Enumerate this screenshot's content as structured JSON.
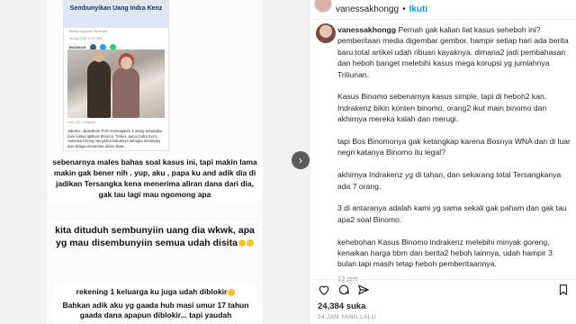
{
  "article": {
    "title": "Sembunyikan Uang Indra Kenz",
    "meta": "Rabiha Adiyanto Rachmadi",
    "date": "25 Ags 2022 11:00 WIB",
    "share_label": "BAGIKAN",
    "comment_label": "Komentar",
    "photo_caption": "Foto: dok. Instagram",
    "body": "Jakarta - Bareskrim Polri menetapkan 3 orang tersangka baru kasus aplikasi Binomo. Terkini, pacar Indra Kenz, Vanessa Khong menyebut kakaknya sebagai tersangka dan diduga menerima aliran dana..."
  },
  "story_text": {
    "b1": "sebenarnya males bahas soal kasus ini, tapi makin lama makin gak bener nih . yup, aku , papa ku and adik dia di jadikan Tersangka kena menerima aliran dana dari dia, gak tau lagi mau ngomong apa",
    "b2": "kita dituduh sembunyiin uang dia wkwk, apa yg mau disembunyiin semua udah disita",
    "b3": "rekening 1 keluarga ku juga udah diblokir",
    "b4": "Bahkan adik aku yg gaada hub masi umur 17 tahun gaada dana apapun diblokir... tapi yaudah"
  },
  "header": {
    "handle": "vanessakhongg",
    "separator": "•",
    "follow_label": "Ikuti"
  },
  "caption": {
    "username": "vanessakhongg",
    "p1": "Pernah gak kalian liat kasus seheboh ini? pemberitaan media digembar gembor, hampir setiap hari ada berita baru.total artikel udah ribuan kayaknya. dimana2 jadi pembahasan dan heboh banget melebihi kasus mega korupsi yg jumlahnya Triliunan.",
    "p2": "Kasus Binomo sebenarnya kasus simple, tapi di heboh2 kan. Indrakenz bikin konten binomo, orang2 ikut main binomo dan akhirnya mereka kalah dan merugi.",
    "p3": "tapi Bos Binomonya gak ketangkap karena Bosnya WNA dan di luar negri katanya Binomo itu legal?",
    "p4": "akhirnya Indrakenz yg di tahan, dan sekarang total Tersangkanya ada 7 orang.",
    "p5": "3 di antaranya adalah kami yg sama sekali gak paham dan gak tau apa2 soal Binomo.",
    "p6": "kehebohan Kasus Binomo indrakenz melebihi minyak goreng, kenaikan harga bbm dan berita2 heboh lainnya, udah hampir 3 bulan tapi masih tetap heboh pemberitaannya.",
    "time": "13 jam"
  },
  "stats": {
    "likes": "24,384 suka",
    "ago": "14 JAM YANG LALU"
  },
  "icons": [
    "heart-icon",
    "comment-icon",
    "share-icon",
    "bookmark-icon",
    "next-arrow-icon"
  ],
  "colors": {
    "accent": "#0095f6",
    "text": "#262626",
    "muted": "#8e8e8e"
  }
}
